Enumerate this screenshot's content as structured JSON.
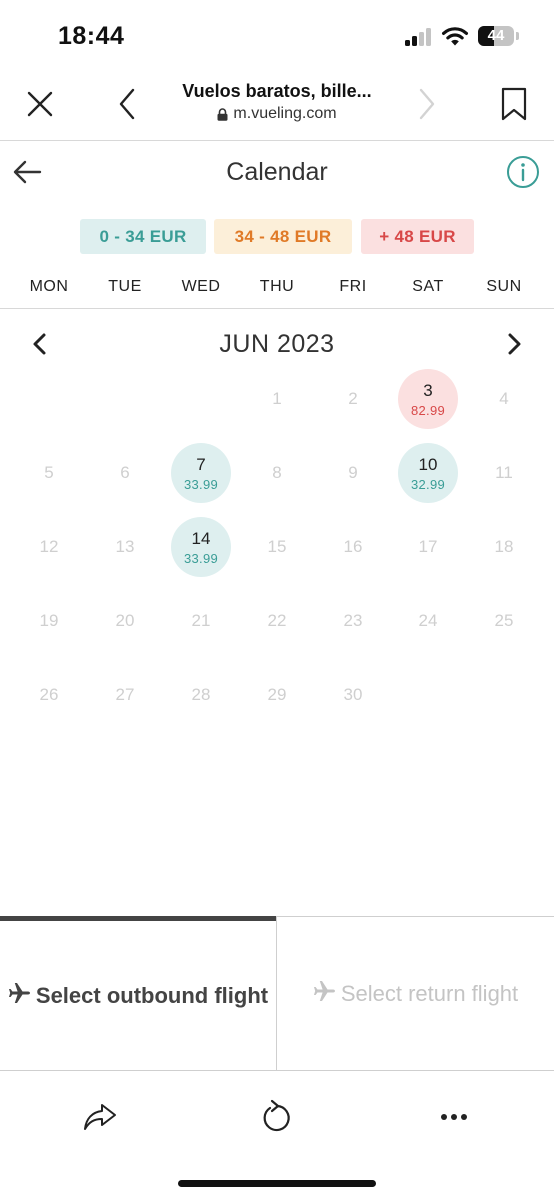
{
  "status_bar": {
    "time": "18:44",
    "battery_level": "44",
    "battery_fraction": 0.44
  },
  "browser": {
    "page_title": "Vuelos baratos, bille...",
    "url": "m.vueling.com",
    "icons": {
      "close": "close-icon",
      "back": "chevron-left-icon",
      "forward": "chevron-right-icon",
      "bookmark": "bookmark-icon",
      "lock": "lock-icon"
    }
  },
  "calendar": {
    "title": "Calendar",
    "icons": {
      "back": "arrow-left-icon",
      "info": "info-icon"
    },
    "legend": [
      {
        "label": "0 - 34 EUR",
        "color": "#3a9d96"
      },
      {
        "label": "34 - 48 EUR",
        "color": "#e07a27"
      },
      {
        "label": "+ 48 EUR",
        "color": "#d84848"
      }
    ],
    "weekdays": [
      "MON",
      "TUE",
      "WED",
      "THU",
      "FRI",
      "SAT",
      "SUN"
    ],
    "month_label": "JUN 2023",
    "first_weekday_index": 3,
    "days_in_month": 30,
    "prices": {
      "3": {
        "price": "82.99",
        "level": "high"
      },
      "7": {
        "price": "33.99",
        "level": "low"
      },
      "10": {
        "price": "32.99",
        "level": "low"
      },
      "14": {
        "price": "33.99",
        "level": "low"
      }
    }
  },
  "flight_tabs": {
    "outbound": {
      "label": "Select outbound flight",
      "active": true
    },
    "return": {
      "label": "Select return flight",
      "active": false
    }
  },
  "bottom_bar": {
    "icons": {
      "share": "share-icon",
      "reload": "reload-icon",
      "more": "more-icon"
    }
  }
}
